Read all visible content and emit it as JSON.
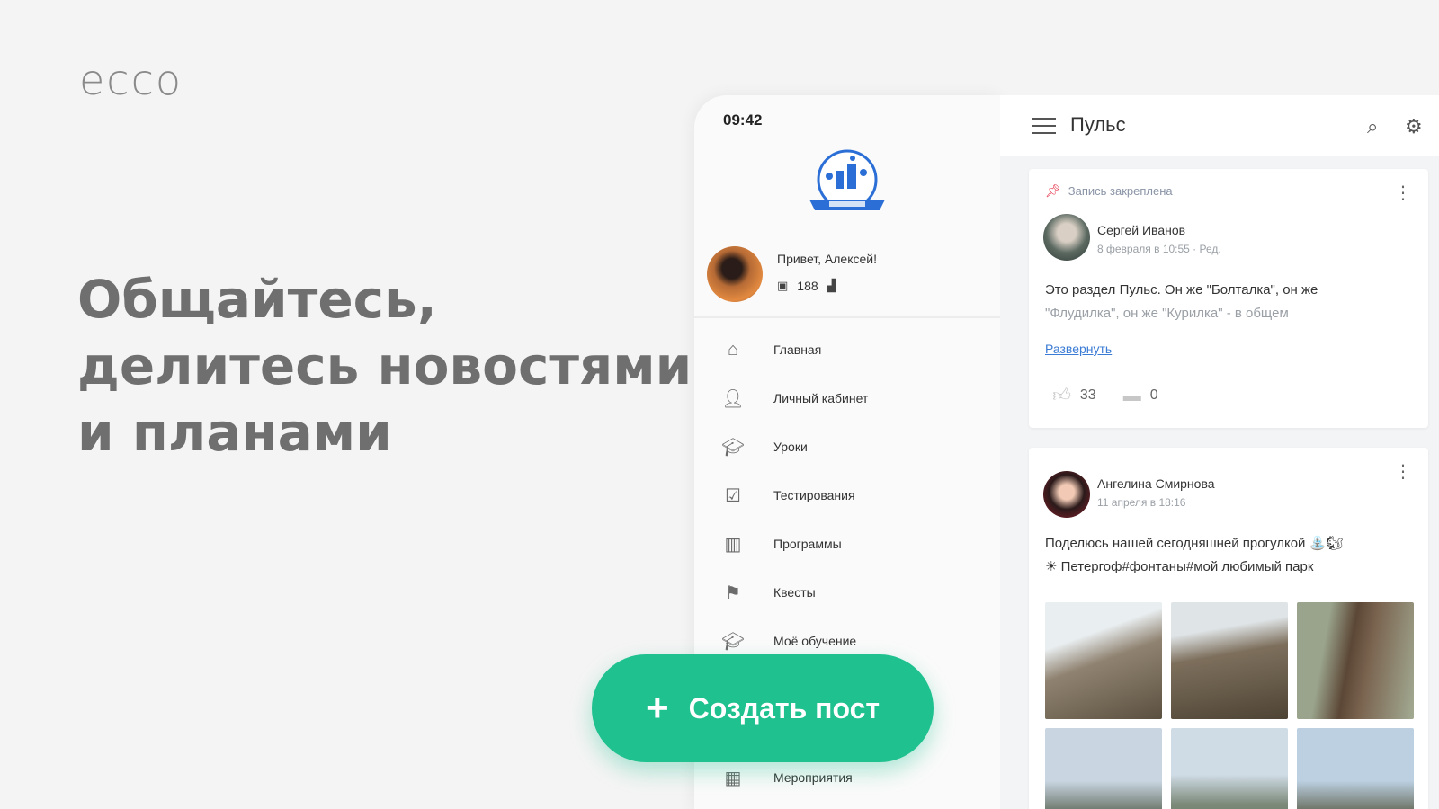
{
  "brand": {
    "logo_text": "ecco"
  },
  "headline": {
    "line1": "Общайтесь,",
    "line2": "делитесь новостями",
    "line3": "и планами"
  },
  "drawer": {
    "status_time": "09:42",
    "profile": {
      "greeting": "Привет, Алексей!",
      "points": "188"
    },
    "menu": [
      {
        "label": "Главная",
        "icon": "home-icon"
      },
      {
        "label": "Личный кабинет",
        "icon": "person-icon"
      },
      {
        "label": "Уроки",
        "icon": "graduation-cap-icon"
      },
      {
        "label": "Тестирования",
        "icon": "checkbox-icon"
      },
      {
        "label": "Программы",
        "icon": "book-icon"
      },
      {
        "label": "Квесты",
        "icon": "quest-map-icon"
      },
      {
        "label": "Моё обучение",
        "icon": "graduation-cap-icon"
      },
      {
        "label": "Мероприятия",
        "icon": "calendar-icon"
      }
    ]
  },
  "feed": {
    "title": "Пульс",
    "posts": [
      {
        "pinned_label": "Запись закреплена",
        "author": "Сергей Иванов",
        "date": "8 февраля в 10:55 · Ред.",
        "text_line1": "Это раздел Пульс. Он же \"Болталка\", он же",
        "text_line2": "\"Флудилка\", он же \"Курилка\" - в общем",
        "expand_label": "Развернуть",
        "likes": "33",
        "comments": "0"
      },
      {
        "author": "Ангелина Смирнова",
        "date": "11 апреля в 18:16",
        "text_line1": "Поделюсь нашей сегодняшней прогулкой ⛲🐿",
        "text_line2": "☀ Петергоф#фонтаны#мой любимый парк"
      }
    ]
  },
  "fab": {
    "label": "Создать пост"
  },
  "colors": {
    "accent": "#1fc18f",
    "link": "#3a7bd5",
    "pin": "#e53950",
    "background": "#f4f4f4"
  }
}
